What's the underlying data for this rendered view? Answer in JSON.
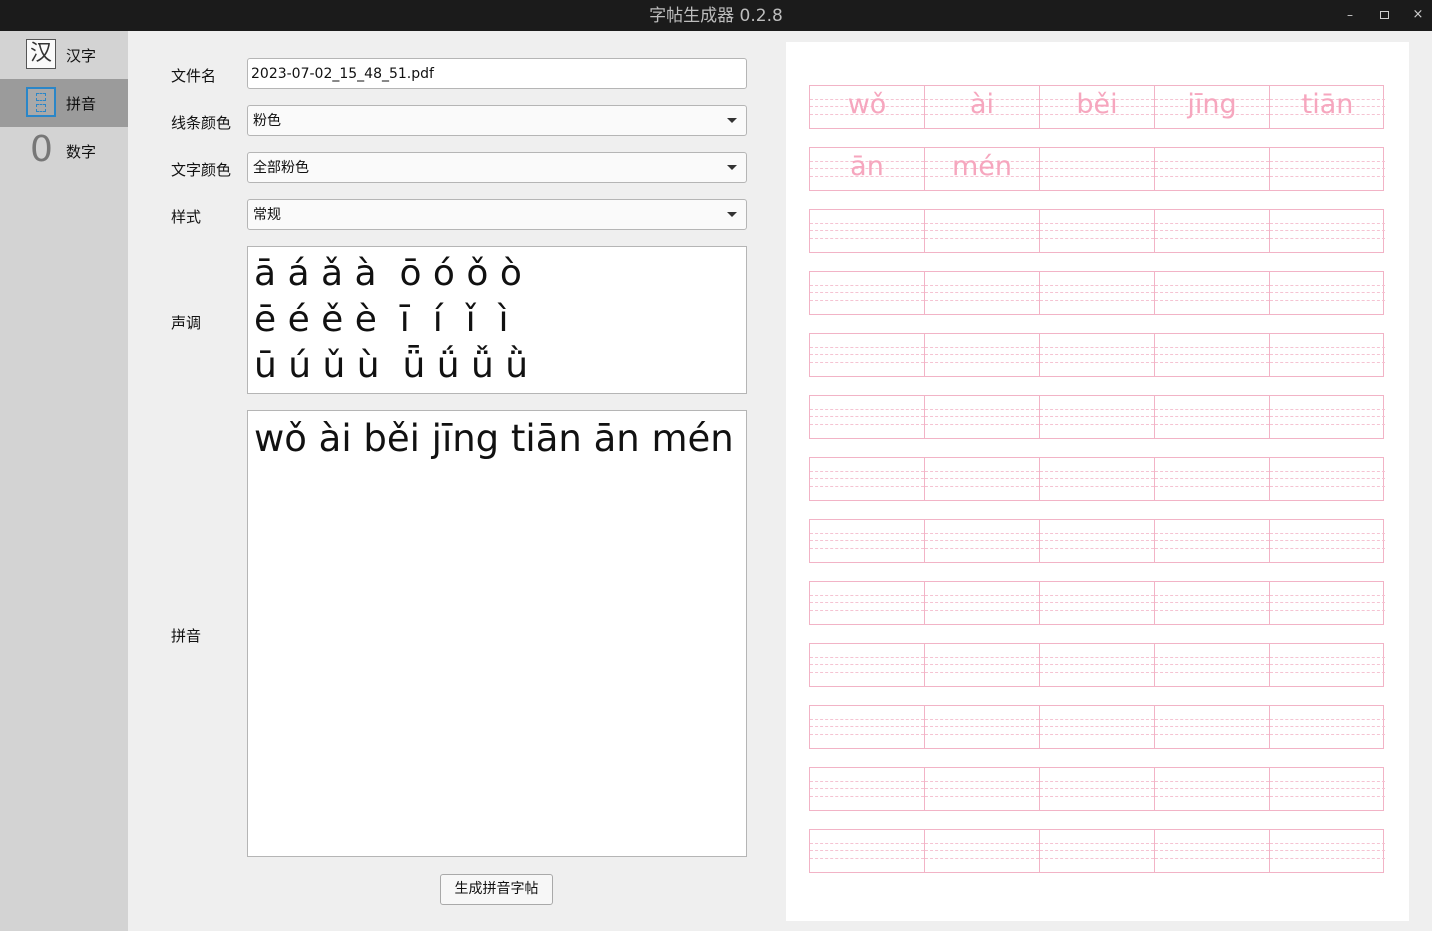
{
  "window": {
    "title": "字帖生成器 0.2.8",
    "min_glyph": "–",
    "close_glyph": "×"
  },
  "sidebar": {
    "items": [
      {
        "label": "汉字",
        "icon": "han-character-icon",
        "icon_glyph": "汉",
        "active": false
      },
      {
        "label": "拼音",
        "icon": "pinyin-icon",
        "active": true
      },
      {
        "label": "数字",
        "icon": "number-icon",
        "icon_glyph": "0",
        "active": false
      }
    ]
  },
  "form": {
    "filename_label": "文件名",
    "filename_value": "2023-07-02_15_48_51.pdf",
    "line_color_label": "线条颜色",
    "line_color_value": "粉色",
    "text_color_label": "文字颜色",
    "text_color_value": "全部粉色",
    "style_label": "样式",
    "style_value": "常规",
    "tones_label": "声调",
    "tones_lines": [
      "ā á ǎ à  ō ó ǒ ò",
      "ē é ě è  ī  í  ǐ  ì",
      "ū ú ǔ ù  ǖ ǘ ǚ ǜ"
    ],
    "pinyin_label": "拼音",
    "pinyin_text": "wǒ ài běi jīng tiān ān mén",
    "generate_button": "生成拼音字帖"
  },
  "preview": {
    "line_color": "#f2b3c6",
    "text_color": "#f6a6be",
    "columns": 5,
    "rows": 13,
    "syllables": [
      "wǒ",
      "ài",
      "běi",
      "jīng",
      "tiān",
      "ān",
      "mén"
    ]
  }
}
